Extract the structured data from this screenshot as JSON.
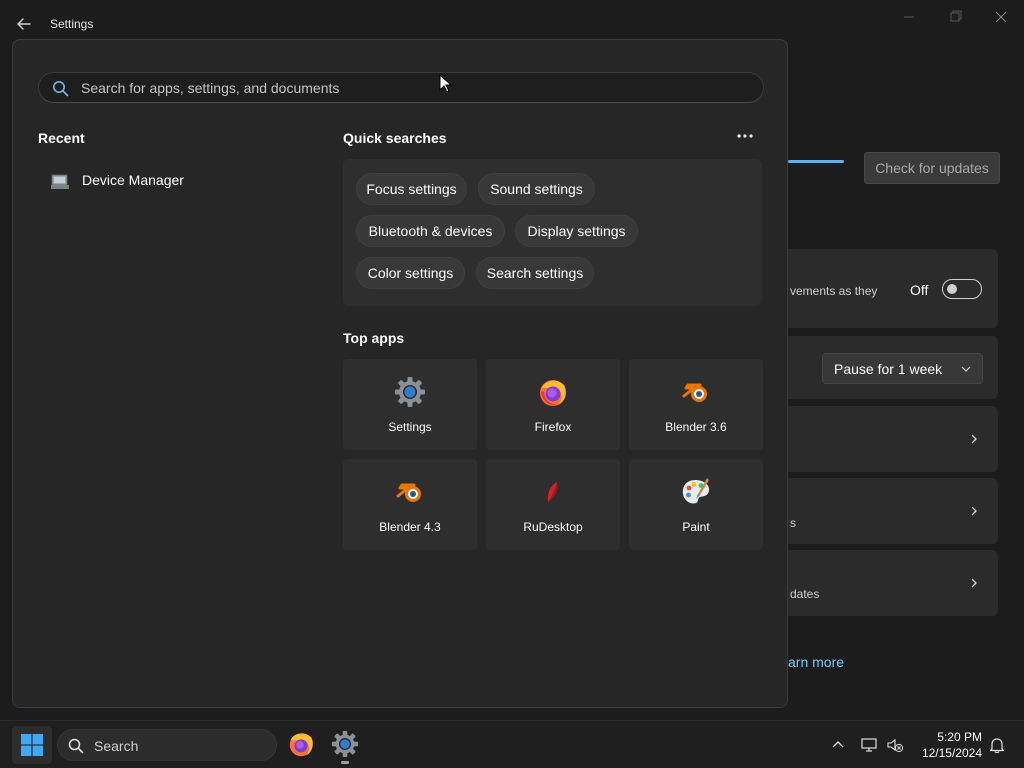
{
  "window": {
    "title": "Settings"
  },
  "background": {
    "check_updates_label": "Check for updates",
    "card1_text": "vements as they",
    "toggle_label": "Off",
    "toggle_on": false,
    "pause_label": "Pause for 1 week",
    "card4_text": "s",
    "card5_text": "dates",
    "learn_more": "arn more"
  },
  "search": {
    "placeholder": "Search for apps, settings, and documents",
    "value": ""
  },
  "recent": {
    "title": "Recent",
    "items": [
      {
        "label": "Device Manager",
        "icon": "device-manager-icon"
      }
    ]
  },
  "quick_searches": {
    "title": "Quick searches",
    "chips": [
      {
        "label": "Focus settings"
      },
      {
        "label": "Sound settings"
      },
      {
        "label": "Bluetooth & devices"
      },
      {
        "label": "Display settings"
      },
      {
        "label": "Color settings"
      },
      {
        "label": "Search settings"
      }
    ]
  },
  "top_apps": {
    "title": "Top apps",
    "apps": [
      {
        "label": "Settings",
        "icon": "settings-gear-icon"
      },
      {
        "label": "Firefox",
        "icon": "firefox-icon"
      },
      {
        "label": "Blender 3.6",
        "icon": "blender-icon"
      },
      {
        "label": "Blender 4.3",
        "icon": "blender-icon"
      },
      {
        "label": "RuDesktop",
        "icon": "rudesktop-icon"
      },
      {
        "label": "Paint",
        "icon": "paint-palette-icon"
      }
    ]
  },
  "taskbar": {
    "search_label": "Search",
    "time": "5:20 PM",
    "date": "12/15/2024"
  },
  "colors": {
    "accent": "#5fb2f2",
    "link": "#6ccbff",
    "flyout_bg": "#262626",
    "window_bg": "#1c1c1c"
  }
}
